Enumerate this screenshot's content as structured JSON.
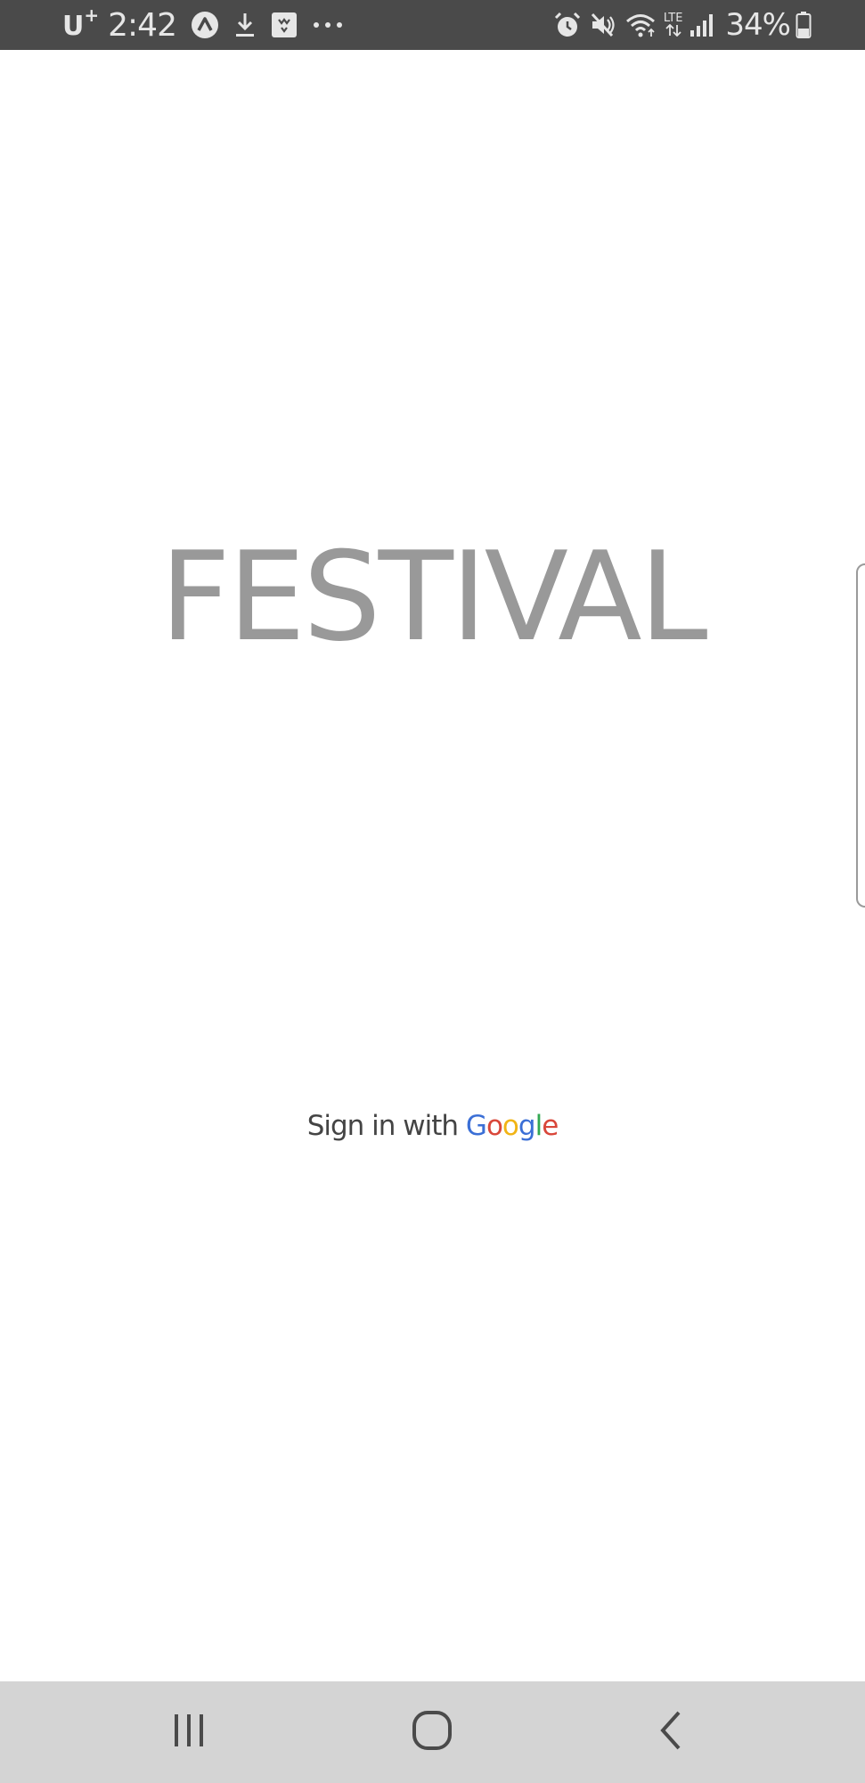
{
  "status_bar": {
    "carrier": "U",
    "carrier_sup": "+",
    "time": "2:42",
    "battery": "34%",
    "left_icons": [
      "a-badge-icon",
      "download-icon",
      "image-icon",
      "more-dots-icon"
    ],
    "right_icons": [
      "alarm-icon",
      "mute-icon",
      "wifi-icon",
      "lte-icon",
      "signal-icon",
      "battery-icon"
    ],
    "lte_label": "LTE"
  },
  "main": {
    "title": "FESTIVAL",
    "title_color": "#999999",
    "signin": {
      "prefix": "Sign in with ",
      "google_letters": [
        {
          "ch": "G",
          "color": "#3b6fd6"
        },
        {
          "ch": "o",
          "color": "#d9473a"
        },
        {
          "ch": "o",
          "color": "#f1b415"
        },
        {
          "ch": "g",
          "color": "#3b6fd6"
        },
        {
          "ch": "l",
          "color": "#32a852"
        },
        {
          "ch": "e",
          "color": "#d9473a"
        }
      ]
    }
  },
  "nav_bar": {
    "buttons": [
      "recents-icon",
      "home-icon",
      "back-icon"
    ],
    "background": "#d4d4d4"
  }
}
